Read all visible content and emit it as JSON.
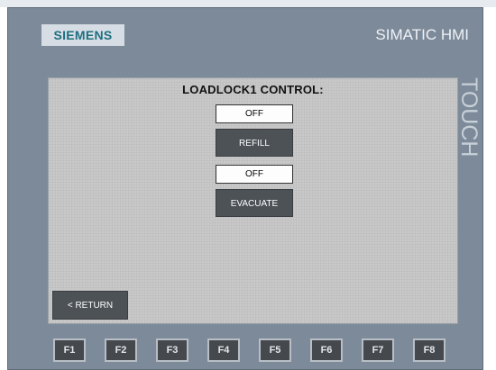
{
  "hmi": {
    "brand": "SIEMENS",
    "model": "SIMATIC HMI",
    "side_label": "TOUCH"
  },
  "screen": {
    "title": "LOADLOCK1 CONTROL:",
    "refill_status": "OFF",
    "refill_label": "REFILL",
    "evacuate_status": "OFF",
    "evacuate_label": "EVACUATE",
    "return_label": "< RETURN"
  },
  "fkeys": [
    "F1",
    "F2",
    "F3",
    "F4",
    "F5",
    "F6",
    "F7",
    "F8"
  ]
}
